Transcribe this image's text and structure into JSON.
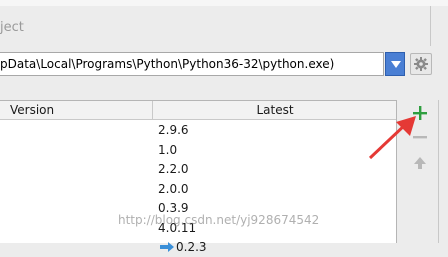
{
  "dialog": {
    "project_label": "ject"
  },
  "interpreter": {
    "path": "pData\\Local\\Programs\\Python\\Python36-32\\python.exe)"
  },
  "table": {
    "headers": {
      "version": "Version",
      "latest": "Latest"
    },
    "rows": [
      {
        "latest": "2.9.6"
      },
      {
        "latest": "1.0"
      },
      {
        "latest": "2.2.0"
      },
      {
        "latest": "2.0.0"
      },
      {
        "latest": "0.3.9"
      },
      {
        "latest": "4.0.11"
      },
      {
        "latest": "0.2.3",
        "upgrade_available": true
      }
    ]
  },
  "toolbar": {
    "add_icon": "plus-icon",
    "remove_icon": "minus-icon",
    "upgrade_icon": "arrow-up-icon"
  },
  "annotation": {
    "color": "#e53935"
  },
  "watermark": {
    "text": "http://blog.csdn.net/yj928674542"
  },
  "colors": {
    "accent": "#4a7fd4",
    "add": "#2e9e3f"
  }
}
